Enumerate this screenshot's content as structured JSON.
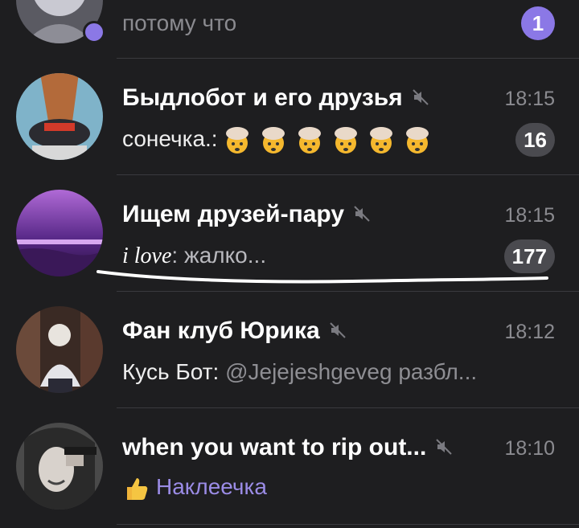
{
  "chats": [
    {
      "preview": "потому что",
      "unread": "1"
    },
    {
      "title": "Быдлобот и его друзья",
      "time": "18:15",
      "sender": "сонечка.:",
      "emoji_count": 6,
      "unread": "16",
      "muted": true
    },
    {
      "title": "Ищем друзей-пару",
      "time": "18:15",
      "sender": "i love",
      "text": ": жалко...",
      "unread": "177",
      "muted": true
    },
    {
      "title": "Фан клуб Юрика",
      "time": "18:12",
      "sender": "Кусь Бот:",
      "text": " @Jejejeshgeveg разбл...",
      "muted": true
    },
    {
      "title": "when you want to rip out...",
      "time": "18:10",
      "emoji_icon": "thumbs-up-emoji",
      "text": "Наклеечка",
      "muted": true
    }
  ],
  "colors": {
    "background": "#1e1e20",
    "accent": "#8b78e6",
    "muted_badge": "#4a4a4f",
    "time": "#8b8b90"
  }
}
